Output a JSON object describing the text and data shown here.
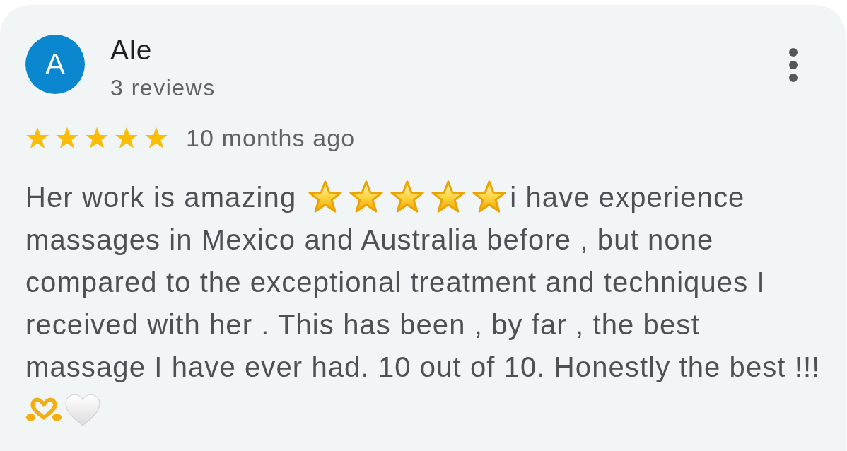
{
  "review": {
    "avatar": {
      "initial": "A"
    },
    "author": "Ale",
    "review_count": "3 reviews",
    "rating": {
      "stars": 5
    },
    "time": "10 months ago",
    "body": [
      {
        "kind": "text",
        "text": "Her work is amazing"
      },
      {
        "kind": "star"
      },
      {
        "kind": "star"
      },
      {
        "kind": "star"
      },
      {
        "kind": "star"
      },
      {
        "kind": "star"
      },
      {
        "kind": "text",
        "text": "i have experience"
      },
      {
        "kind": "text",
        "text": "massages in Mexico and Australia before , but none compared to the exceptional treatment and techniques I received with her . This has been , by far , the best massage I have ever had. 10 out of 10. Honestly the best !!!"
      },
      {
        "kind": "heart_hands"
      },
      {
        "kind": "white_heart"
      }
    ]
  }
}
